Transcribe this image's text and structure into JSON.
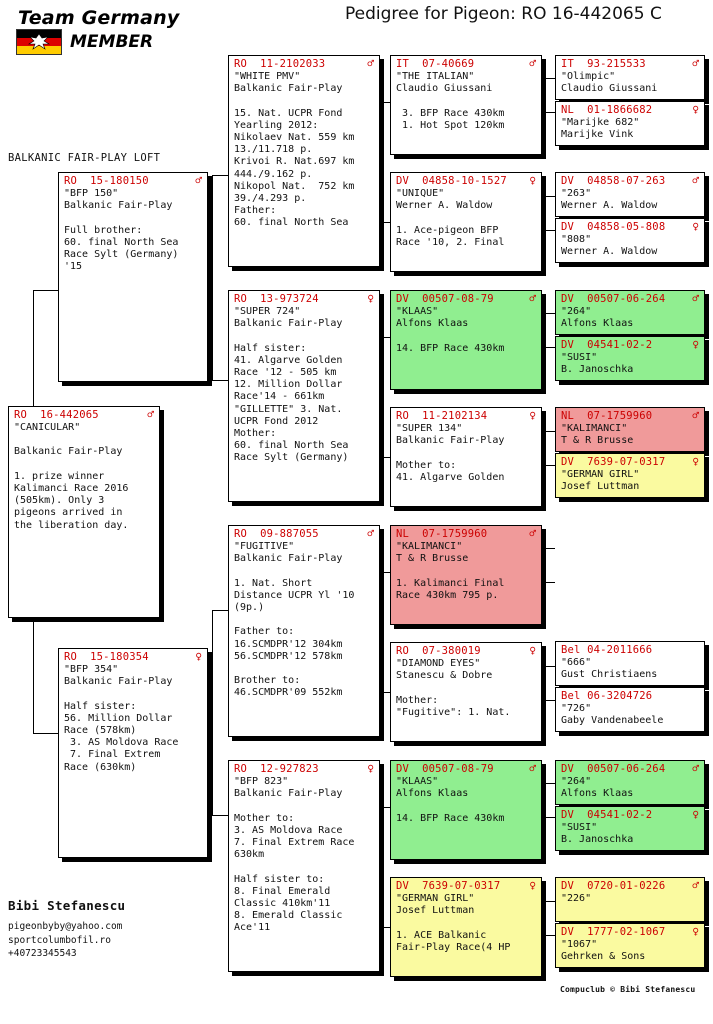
{
  "header": {
    "logo_team": "Team Germany",
    "logo_member": "MEMBER",
    "title": "Pedigree for Pigeon: RO  16-442065 C"
  },
  "loft_label": "BALKANIC FAIR-PLAY LOFT",
  "footer": {
    "owner": "Bibi Stefanescu",
    "contact": "pigeonbyby@yahoo.com\nsportcolumbofil.ro\n+40723345543",
    "compuclub": "Compuclub © Bibi Stefanescu"
  },
  "symbols": {
    "male": "♂",
    "female": "♀"
  },
  "colors": {
    "id_red": "#cc0000",
    "green": "#90ee90",
    "pink": "#f09a9a",
    "yellow": "#fafaa0",
    "white": "#ffffff"
  },
  "boxes": {
    "subject": {
      "id": "RO  16-442065",
      "sex": "male",
      "body": "\"CANICULAR\"\n\nBalkanic Fair-Play\n\n1. prize winner\nKalimanci Race 2016\n(505km). Only 3\npigeons arrived in\nthe liberation day.",
      "color": "white"
    },
    "sire": {
      "id": "RO  15-180150",
      "sex": "male",
      "body": "\"BFP 150\"\nBalkanic Fair-Play\n\nFull brother:\n60. final North Sea\nRace Sylt (Germany)\n'15",
      "color": "white"
    },
    "dam": {
      "id": "RO  15-180354",
      "sex": "female",
      "body": "\"BFP 354\"\nBalkanic Fair-Play\n\nHalf sister:\n56. Million Dollar\nRace (578km)\n 3. AS Moldova Race\n 7. Final Extrem\nRace (630km)",
      "color": "white"
    },
    "gp1": {
      "id": "RO  11-2102033",
      "sex": "male",
      "body": "\"WHITE PMV\"\nBalkanic Fair-Play\n\n15. Nat. UCPR Fond\nYearling 2012:\nNikolaev Nat. 559 km\n13./11.718 p.\nKrivoi R. Nat.697 km\n444./9.162 p.\nNikopol Nat.  752 km\n39./4.293 p.\nFather:\n60. final North Sea",
      "color": "white"
    },
    "gp2": {
      "id": "RO  13-973724",
      "sex": "female",
      "body": "\"SUPER 724\"\nBalkanic Fair-Play\n\nHalf sister:\n41. Algarve Golden\nRace '12 - 505 km\n12. Million Dollar\nRace'14 - 661km\n\"GILLETTE\" 3. Nat.\nUCPR Fond 2012\nMother:\n60. final North Sea\nRace Sylt (Germany)",
      "color": "white"
    },
    "gp3": {
      "id": "RO  09-887055",
      "sex": "male",
      "body": "\"FUGITIVE\"\nBalkanic Fair-Play\n\n1. Nat. Short\nDistance UCPR Yl '10\n(9p.)\n\nFather to:\n16.SCMDPR'12 304km\n56.SCMDPR'12 578km\n\nBrother to:\n46.SCMDPR'09 552km",
      "color": "white"
    },
    "gp4": {
      "id": "RO  12-927823",
      "sex": "female",
      "body": "\"BFP 823\"\nBalkanic Fair-Play\n\nMother to:\n3. AS Moldova Race\n7. Final Extrem Race\n630km\n\nHalf sister to:\n8. Final Emerald\nClassic 410km'11\n8. Emerald Classic\nAce'11",
      "color": "white"
    },
    "ggp1": {
      "id": "IT  07-40669",
      "sex": "male",
      "body": "\"THE ITALIAN\"\nClaudio Giussani\n\n 3. BFP Race 430km\n 1. Hot Spot 120km",
      "color": "white"
    },
    "ggp2": {
      "id": "DV  04858-10-1527",
      "sex": "female",
      "body": "\"UNIQUE\"\nWerner A. Waldow\n\n1. Ace-pigeon BFP\nRace '10, 2. Final",
      "color": "white"
    },
    "ggp3": {
      "id": "DV  00507-08-79",
      "sex": "male",
      "body": "\"KLAAS\"\nAlfons Klaas\n\n14. BFP Race 430km",
      "color": "green"
    },
    "ggp4": {
      "id": "RO  11-2102134",
      "sex": "female",
      "body": "\"SUPER 134\"\nBalkanic Fair-Play\n\nMother to:\n41. Algarve Golden",
      "color": "white"
    },
    "ggp5": {
      "id": "NL  07-1759960",
      "sex": "male",
      "body": "\"KALIMANCI\"\nT & R Brusse\n\n1. Kalimanci Final\nRace 430km 795 p.",
      "color": "pink"
    },
    "ggp6": {
      "id": "RO  07-380019",
      "sex": "female",
      "body": "\"DIAMOND EYES\"\nStanescu & Dobre\n\nMother:\n\"Fugitive\": 1. Nat.",
      "color": "white"
    },
    "ggp7": {
      "id": "DV  00507-08-79",
      "sex": "male",
      "body": "\"KLAAS\"\nAlfons Klaas\n\n14. BFP Race 430km",
      "color": "green"
    },
    "ggp8": {
      "id": "DV  7639-07-0317",
      "sex": "female",
      "body": "\"GERMAN GIRL\"\nJosef Luttman\n\n1. ACE Balkanic\nFair-Play Race(4 HP",
      "color": "yellow"
    },
    "gggp1": {
      "id": "IT  93-215533",
      "sex": "male",
      "body": "\"Olimpic\"\nClaudio Giussani",
      "color": "white"
    },
    "gggp2": {
      "id": "NL  01-1866682",
      "sex": "female",
      "body": "\"Marijke 682\"\nMarijke Vink",
      "color": "white"
    },
    "gggp3": {
      "id": "DV  04858-07-263",
      "sex": "male",
      "body": "\"263\"\nWerner A. Waldow",
      "color": "white"
    },
    "gggp4": {
      "id": "DV  04858-05-808",
      "sex": "female",
      "body": "\"808\"\nWerner A. Waldow",
      "color": "white"
    },
    "gggp5": {
      "id": "DV  00507-06-264",
      "sex": "male",
      "body": "\"264\"\nAlfons Klaas",
      "color": "green"
    },
    "gggp6": {
      "id": "DV  04541-02-2",
      "sex": "female",
      "body": "\"SUSI\"\nB. Janoschka",
      "color": "green"
    },
    "gggp7": {
      "id": "NL  07-1759960",
      "sex": "male",
      "body": "\"KALIMANCI\"\nT & R Brusse",
      "color": "pink"
    },
    "gggp8": {
      "id": "DV  7639-07-0317",
      "sex": "female",
      "body": "\"GERMAN GIRL\"\nJosef Luttman",
      "color": "yellow"
    },
    "gggp9": {
      "id": "Bel 04-2011666",
      "sex": "none",
      "body": "\"666\"\nGust Christiaens",
      "color": "white"
    },
    "gggp10": {
      "id": "Bel 06-3204726",
      "sex": "none",
      "body": "\"726\"\nGaby Vandenabeele",
      "color": "white"
    },
    "gggp11": {
      "id": "DV  00507-06-264",
      "sex": "male",
      "body": "\"264\"\nAlfons Klaas",
      "color": "green"
    },
    "gggp12": {
      "id": "DV  04541-02-2",
      "sex": "female",
      "body": "\"SUSI\"\nB. Janoschka",
      "color": "green"
    },
    "gggp13": {
      "id": "DV  0720-01-0226",
      "sex": "male",
      "body": "\"226\"",
      "color": "yellow"
    },
    "gggp14": {
      "id": "DV  1777-02-1067",
      "sex": "female",
      "body": "\"1067\"\nGehrken & Sons",
      "color": "yellow"
    }
  }
}
